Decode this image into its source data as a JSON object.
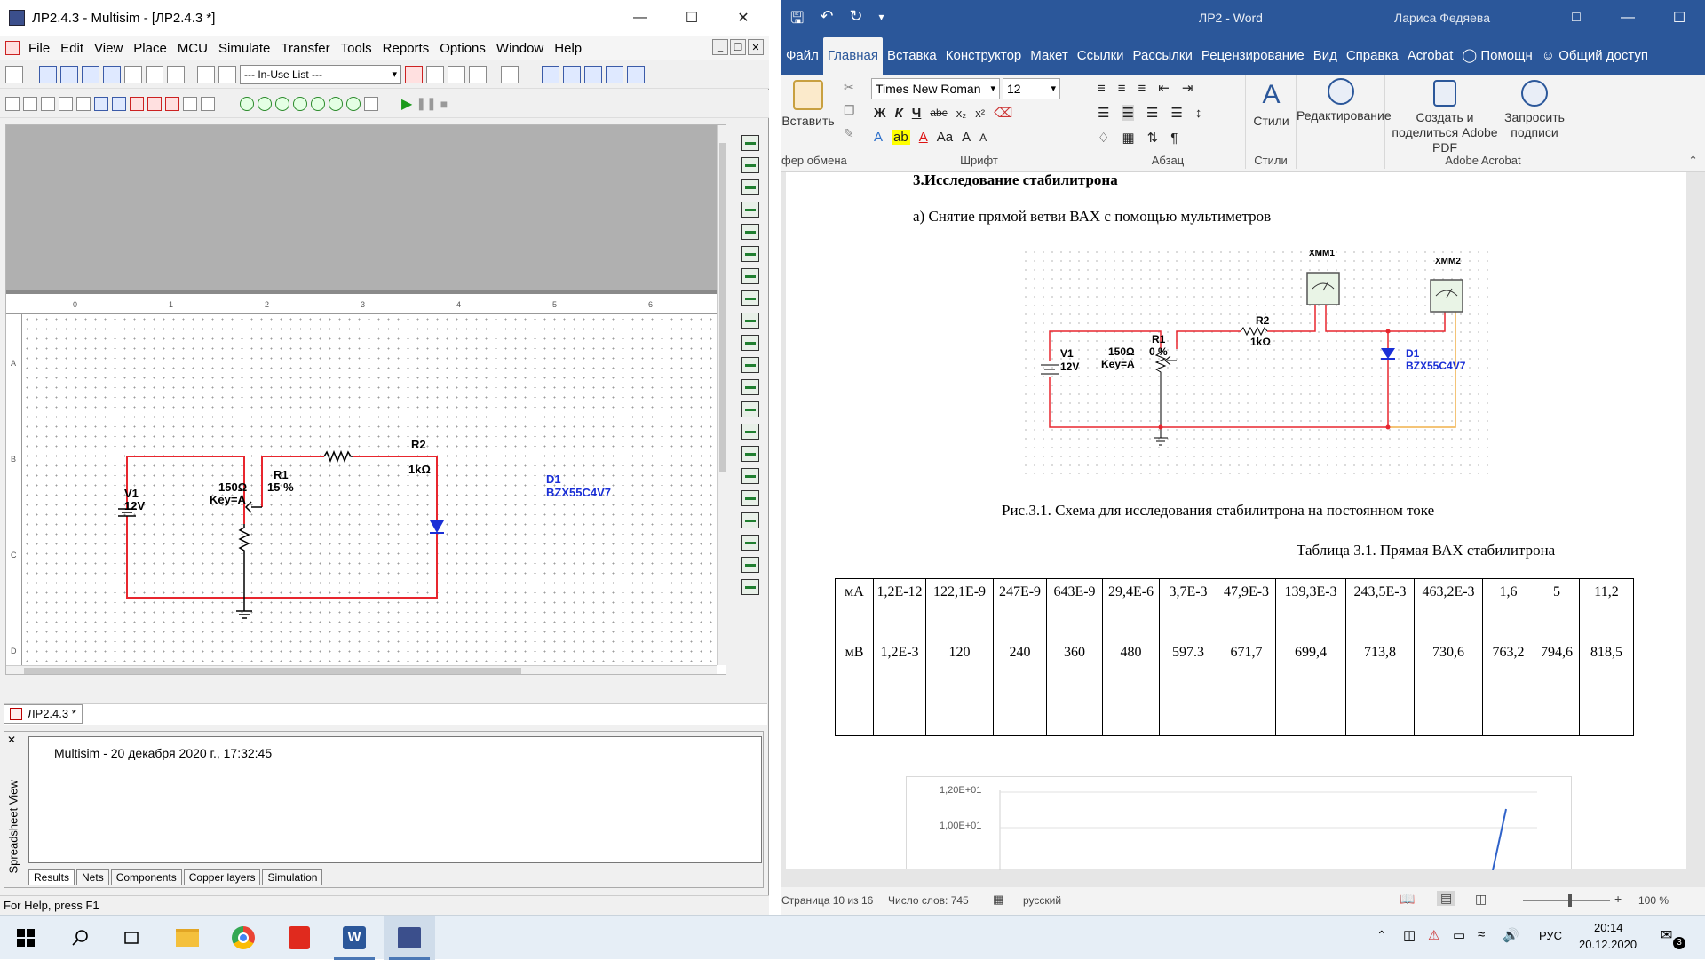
{
  "multisim": {
    "window_title": "ЛР2.4.3 - Multisim - [ЛР2.4.3 *]",
    "menu": [
      "File",
      "Edit",
      "View",
      "Place",
      "MCU",
      "Simulate",
      "Transfer",
      "Tools",
      "Reports",
      "Options",
      "Window",
      "Help"
    ],
    "in_use_list": "--- In-Use List ---",
    "ruler_numbers": [
      "0",
      "1",
      "2",
      "3",
      "4",
      "5",
      "6"
    ],
    "row_letters": [
      "A",
      "B",
      "C",
      "D"
    ],
    "circuit": {
      "v1_name": "V1",
      "v1_value": "12V",
      "r1_name": "R1",
      "r1_value": "150Ω",
      "r1_percent": "15 %",
      "r1_key": "Key=A",
      "r2_name": "R2",
      "r2_value": "1kΩ",
      "d1_name": "D1",
      "d1_model": "BZX55C4V7"
    },
    "doc_tab": "ЛР2.4.3 *",
    "spreadsheet_label": "Spreadsheet View",
    "results_line": "Multisim  -  20 декабря 2020 г., 17:32:45",
    "sheet_tabs": [
      "Results",
      "Nets",
      "Components",
      "Copper layers",
      "Simulation"
    ],
    "status": "For Help, press F1"
  },
  "word": {
    "title": "ЛР2  -  Word",
    "user": "Лариса Федяева",
    "tabs": [
      "Файл",
      "Главная",
      "Вставка",
      "Конструктор",
      "Макет",
      "Ссылки",
      "Рассылки",
      "Рецензирование",
      "Вид",
      "Справка",
      "Acrobat"
    ],
    "help_search": "Помощн",
    "share": "Общий доступ",
    "ribbon": {
      "paste": "Вставить",
      "clipboard_group": "фер обмена",
      "font_name": "Times New Roman",
      "font_size": "12",
      "font_group": "Шрифт",
      "paragraph_group": "Абзац",
      "styles": "Стили",
      "styles_group": "Стили",
      "editing": "Редактирование",
      "acrobat_create": "Создать и поделиться Adobe PDF",
      "acrobat_request": "Запросить подписи",
      "acrobat_group": "Adobe Acrobat"
    },
    "doc": {
      "heading": "3.Исследование стабилитрона",
      "subheading": "а) Снятие прямой ветви ВАХ с помощью мультиметров",
      "circuit": {
        "xmm1": "XMM1",
        "xmm2": "XMM2",
        "v1_name": "V1",
        "v1_value": "12V",
        "r1_name": "R1",
        "r1_value": "150Ω",
        "r1_percent": "0 %",
        "r1_key": "Key=A",
        "r2_name": "R2",
        "r2_value": "1kΩ",
        "d1_name": "D1",
        "d1_model": "BZX55C4V7"
      },
      "figure_caption": "Рис.3.1. Схема для исследования стабилитрона на постоянном токе",
      "table_caption": "Таблица 3.1. Прямая ВАХ стабилитрона",
      "table": {
        "row1_header": "мА",
        "row1": [
          "1,2E-12",
          "122,1E-9",
          "247E-9",
          "643E-9",
          "29,4E-6",
          "3,7E-3",
          "47,9E-3",
          "139,3E-3",
          "243,5E-3",
          "463,2E-3",
          "1,6",
          "5",
          "11,2"
        ],
        "row2_header": "мВ",
        "row2": [
          "1,2E-3",
          "120",
          "240",
          "360",
          "480",
          "597.3",
          "671,7",
          "699,4",
          "713,8",
          "730,6",
          "763,2",
          "794,6",
          "818,5"
        ]
      },
      "chart_y_ticks": [
        "1,20E+01",
        "1,00E+01"
      ]
    },
    "status": {
      "page": "Страница 10 из 16",
      "words": "Число слов: 745",
      "language": "русский",
      "zoom": "100 %"
    }
  },
  "taskbar": {
    "lang": "РУС",
    "time": "20:14",
    "date": "20.12.2020",
    "notif_count": "3"
  },
  "chart_data": {
    "type": "line",
    "yticks": [
      "1,20E+01",
      "1,00E+01"
    ]
  }
}
